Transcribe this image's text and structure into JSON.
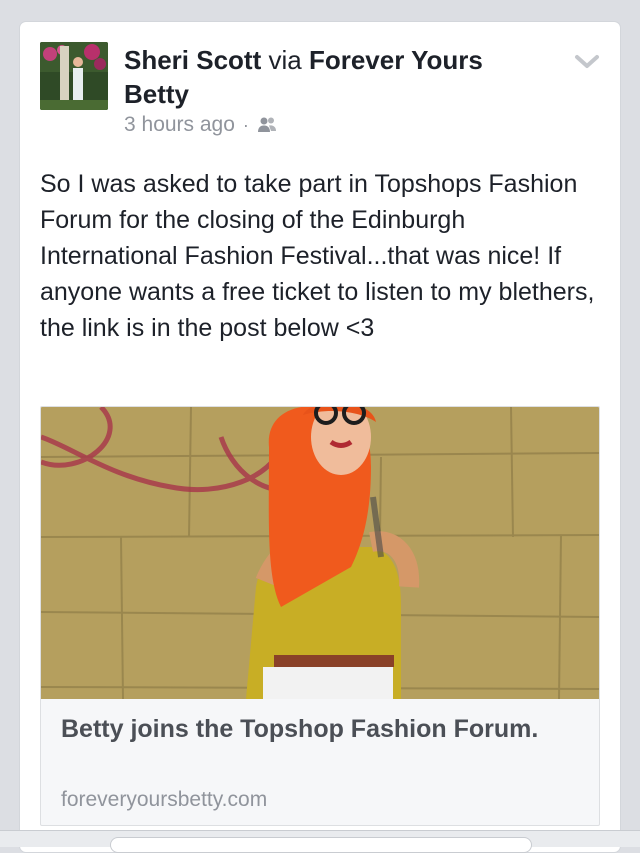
{
  "post": {
    "author": "Sheri Scott",
    "via_word": "via",
    "page": "Forever Yours Betty",
    "timestamp": "3 hours ago",
    "separator": "·",
    "audience_icon": "friends-icon",
    "menu_icon": "chevron-down-icon",
    "text": "So I was asked to take part in Topshops Fashion Forum for the closing of the Edinburgh International Fashion Festival...that was nice! If anyone wants a free ticket to listen to my blethers, the link is in the post below <3"
  },
  "link": {
    "title": "Betty joins the Topshop Fashion Forum.",
    "domain": "foreveryoursbetty.com"
  },
  "colors": {
    "background": "#dcdee3",
    "card": "#ffffff",
    "text": "#1d2129",
    "meta": "#90949c",
    "link_title": "#4b4f56"
  }
}
